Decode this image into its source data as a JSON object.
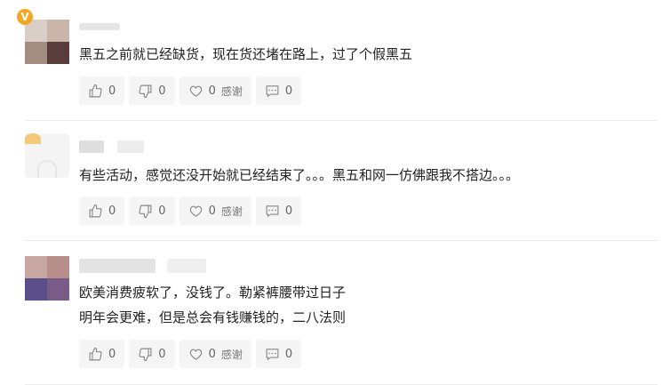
{
  "comments": [
    {
      "lines": [
        "黑五之前就已经缺货，现在货还堵在路上，过了个假黑五"
      ],
      "actions": {
        "like": "0",
        "dislike": "0",
        "thanks_count": "0",
        "thanks_label": "感谢",
        "reply": "0"
      },
      "badge": "V"
    },
    {
      "lines": [
        "有些活动，感觉还没开始就已经结束了。。。黑五和网一仿佛跟我不搭边。。。"
      ],
      "actions": {
        "like": "0",
        "dislike": "0",
        "thanks_count": "0",
        "thanks_label": "感谢",
        "reply": "0"
      }
    },
    {
      "lines": [
        "欧美消费疲软了，没钱了。勒紧裤腰带过日子",
        "明年会更难，但是总会有钱赚钱的，二八法则"
      ],
      "actions": {
        "like": "0",
        "dislike": "0",
        "thanks_count": "0",
        "thanks_label": "感谢",
        "reply": "0"
      }
    }
  ],
  "colors": {
    "badge": "#f5a623",
    "button_bg": "#f5f5f5",
    "icon": "#888888"
  },
  "icons": {
    "like": "thumbs-up-icon",
    "dislike": "thumbs-down-icon",
    "thanks": "heart-icon",
    "reply": "comment-icon"
  }
}
